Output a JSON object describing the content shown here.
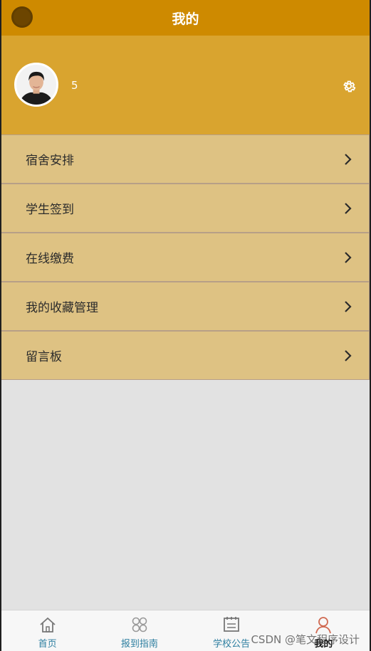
{
  "header": {
    "title": "我的"
  },
  "profile": {
    "username": "5"
  },
  "menu": {
    "items": [
      {
        "label": "宿舍安排"
      },
      {
        "label": "学生签到"
      },
      {
        "label": "在线缴费"
      },
      {
        "label": "我的收藏管理"
      },
      {
        "label": "留言板"
      }
    ]
  },
  "tabbar": {
    "tabs": [
      {
        "label": "首页",
        "icon": "home-icon"
      },
      {
        "label": "报到指南",
        "icon": "grid-icon"
      },
      {
        "label": "学校公告",
        "icon": "notice-icon"
      },
      {
        "label": "我的",
        "icon": "user-icon"
      }
    ]
  },
  "watermark": {
    "text": "CSDN @笔文程序设计"
  },
  "colors": {
    "header": "#ce8a00",
    "profile_bg": "#d9a42f",
    "menu_bg": "#dec283",
    "tab_label": "#2e7fa0"
  }
}
